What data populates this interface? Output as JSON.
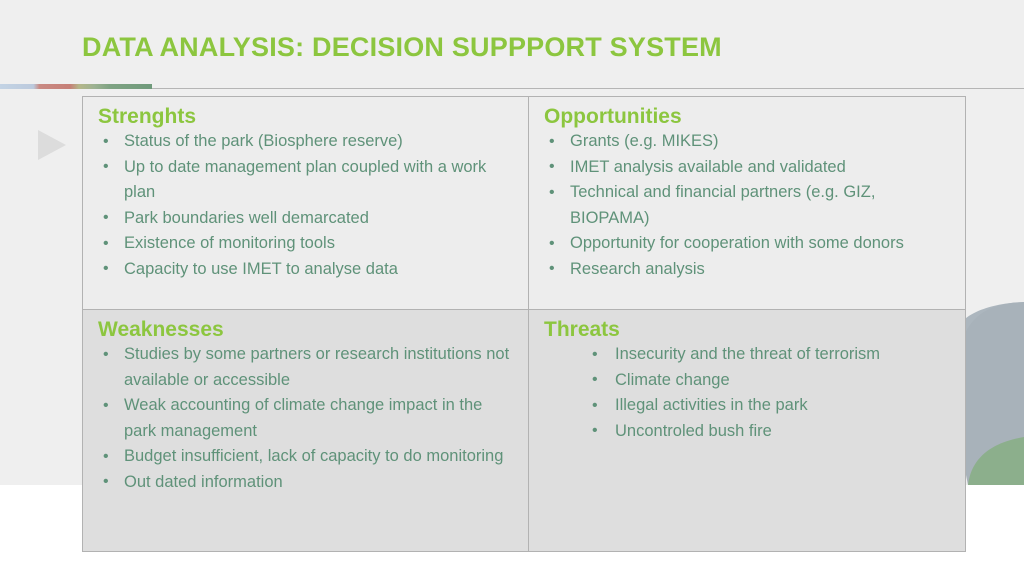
{
  "slide": {
    "title": "DATA ANALYSIS: DECISION SUPPPORT SYSTEM",
    "background_color": "#efefef",
    "accent_green": "#8cc63f",
    "body_text_color": "#5f9279"
  },
  "swot": {
    "strengths": {
      "heading": "Strenghts",
      "items": [
        "Status of the park (Biosphere reserve)",
        "Up to date management plan coupled with a work plan",
        "Park boundaries well demarcated",
        "Existence of monitoring tools",
        "Capacity to use IMET to analyse data"
      ]
    },
    "opportunities": {
      "heading": "Opportunities",
      "items": [
        "Grants (e.g. MIKES)",
        "IMET analysis available and validated",
        "Technical and financial partners (e.g. GIZ, BIOPAMA)",
        "Opportunity for cooperation with some donors",
        "Research analysis"
      ]
    },
    "weaknesses": {
      "heading": "Weaknesses",
      "items": [
        "Studies by some partners or research institutions not available or accessible",
        "Weak accounting of climate change impact in the park management",
        "Budget insufficient, lack of capacity to do monitoring",
        "Out dated information"
      ]
    },
    "threats": {
      "heading": "Threats",
      "items": [
        "Insecurity and the threat of terrorism",
        "Climate change",
        "Illegal activities in the park",
        "Uncontroled bush fire"
      ]
    }
  },
  "decorations": {
    "triangle_color": "#dcdcdc",
    "shape_blue_gray": "#a8b2ba",
    "shape_green": "#8caf8c",
    "accent_bar_colors": [
      "#c3d3e4",
      "#c67f77",
      "#6f9a7b"
    ]
  }
}
